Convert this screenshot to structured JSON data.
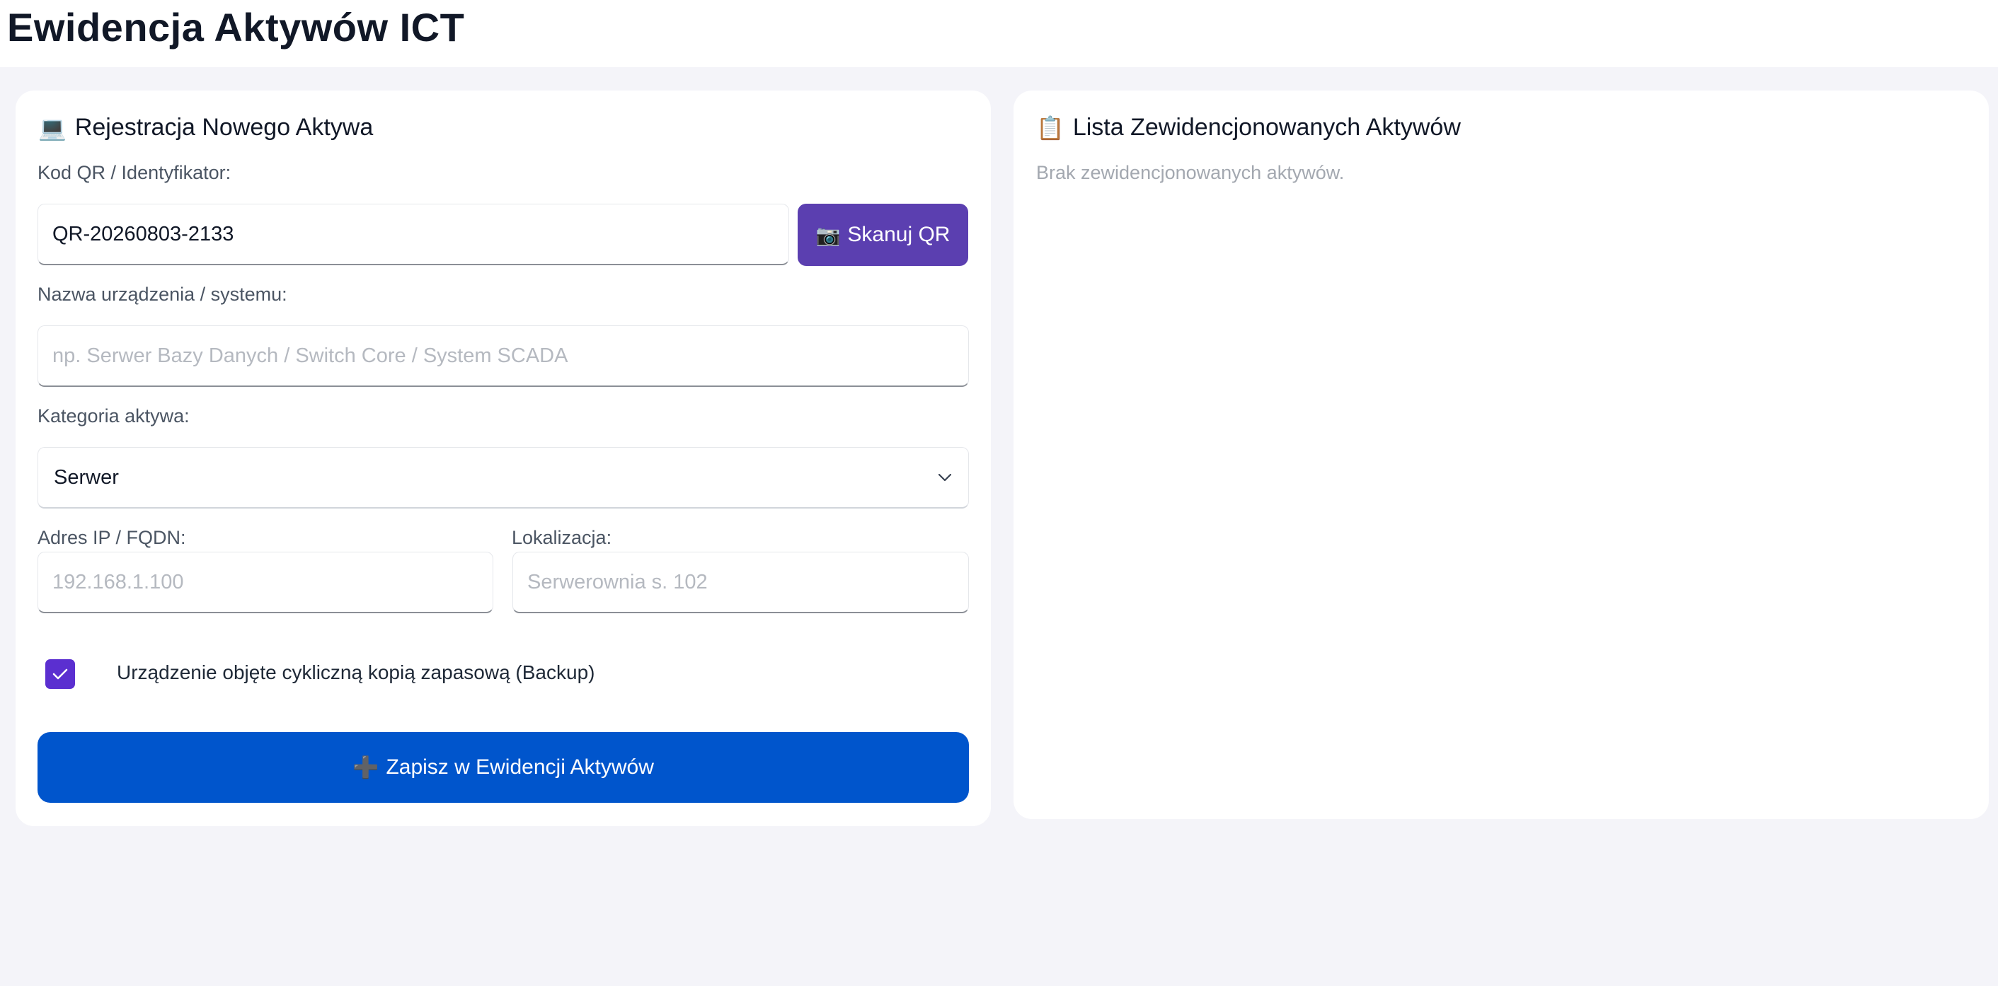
{
  "header": {
    "title": "Ewidencja Aktywów ICT"
  },
  "form": {
    "title_icon": "💻",
    "title": "Rejestracja Nowego Aktywa",
    "qr_label": "Kod QR / Identyfikator:",
    "qr_value": "QR-20260803-2133",
    "scan_icon": "📷",
    "scan_label": "Skanuj QR",
    "name_label": "Nazwa urządzenia / systemu:",
    "name_placeholder": "np. Serwer Bazy Danych / Switch Core / System SCADA",
    "category_label": "Kategoria aktywa:",
    "category_value": "Serwer",
    "ip_label": "Adres IP / FQDN:",
    "ip_placeholder": "192.168.1.100",
    "location_label": "Lokalizacja:",
    "location_placeholder": "Serwerownia s. 102",
    "backup_checked": true,
    "backup_label": "Urządzenie objęte cykliczną kopią zapasową (Backup)",
    "save_icon": "➕",
    "save_label": "Zapisz w Ewidencji Aktywów"
  },
  "list": {
    "title_icon": "📋",
    "title": "Lista Zewidencjonowanych Aktywów",
    "empty_text": "Brak zewidencjonowanych aktywów."
  },
  "colors": {
    "scan_button": "#5b3fb0",
    "checkbox": "#5b2fd0",
    "save_button": "#0055cc",
    "page_background": "#f4f4f9"
  }
}
